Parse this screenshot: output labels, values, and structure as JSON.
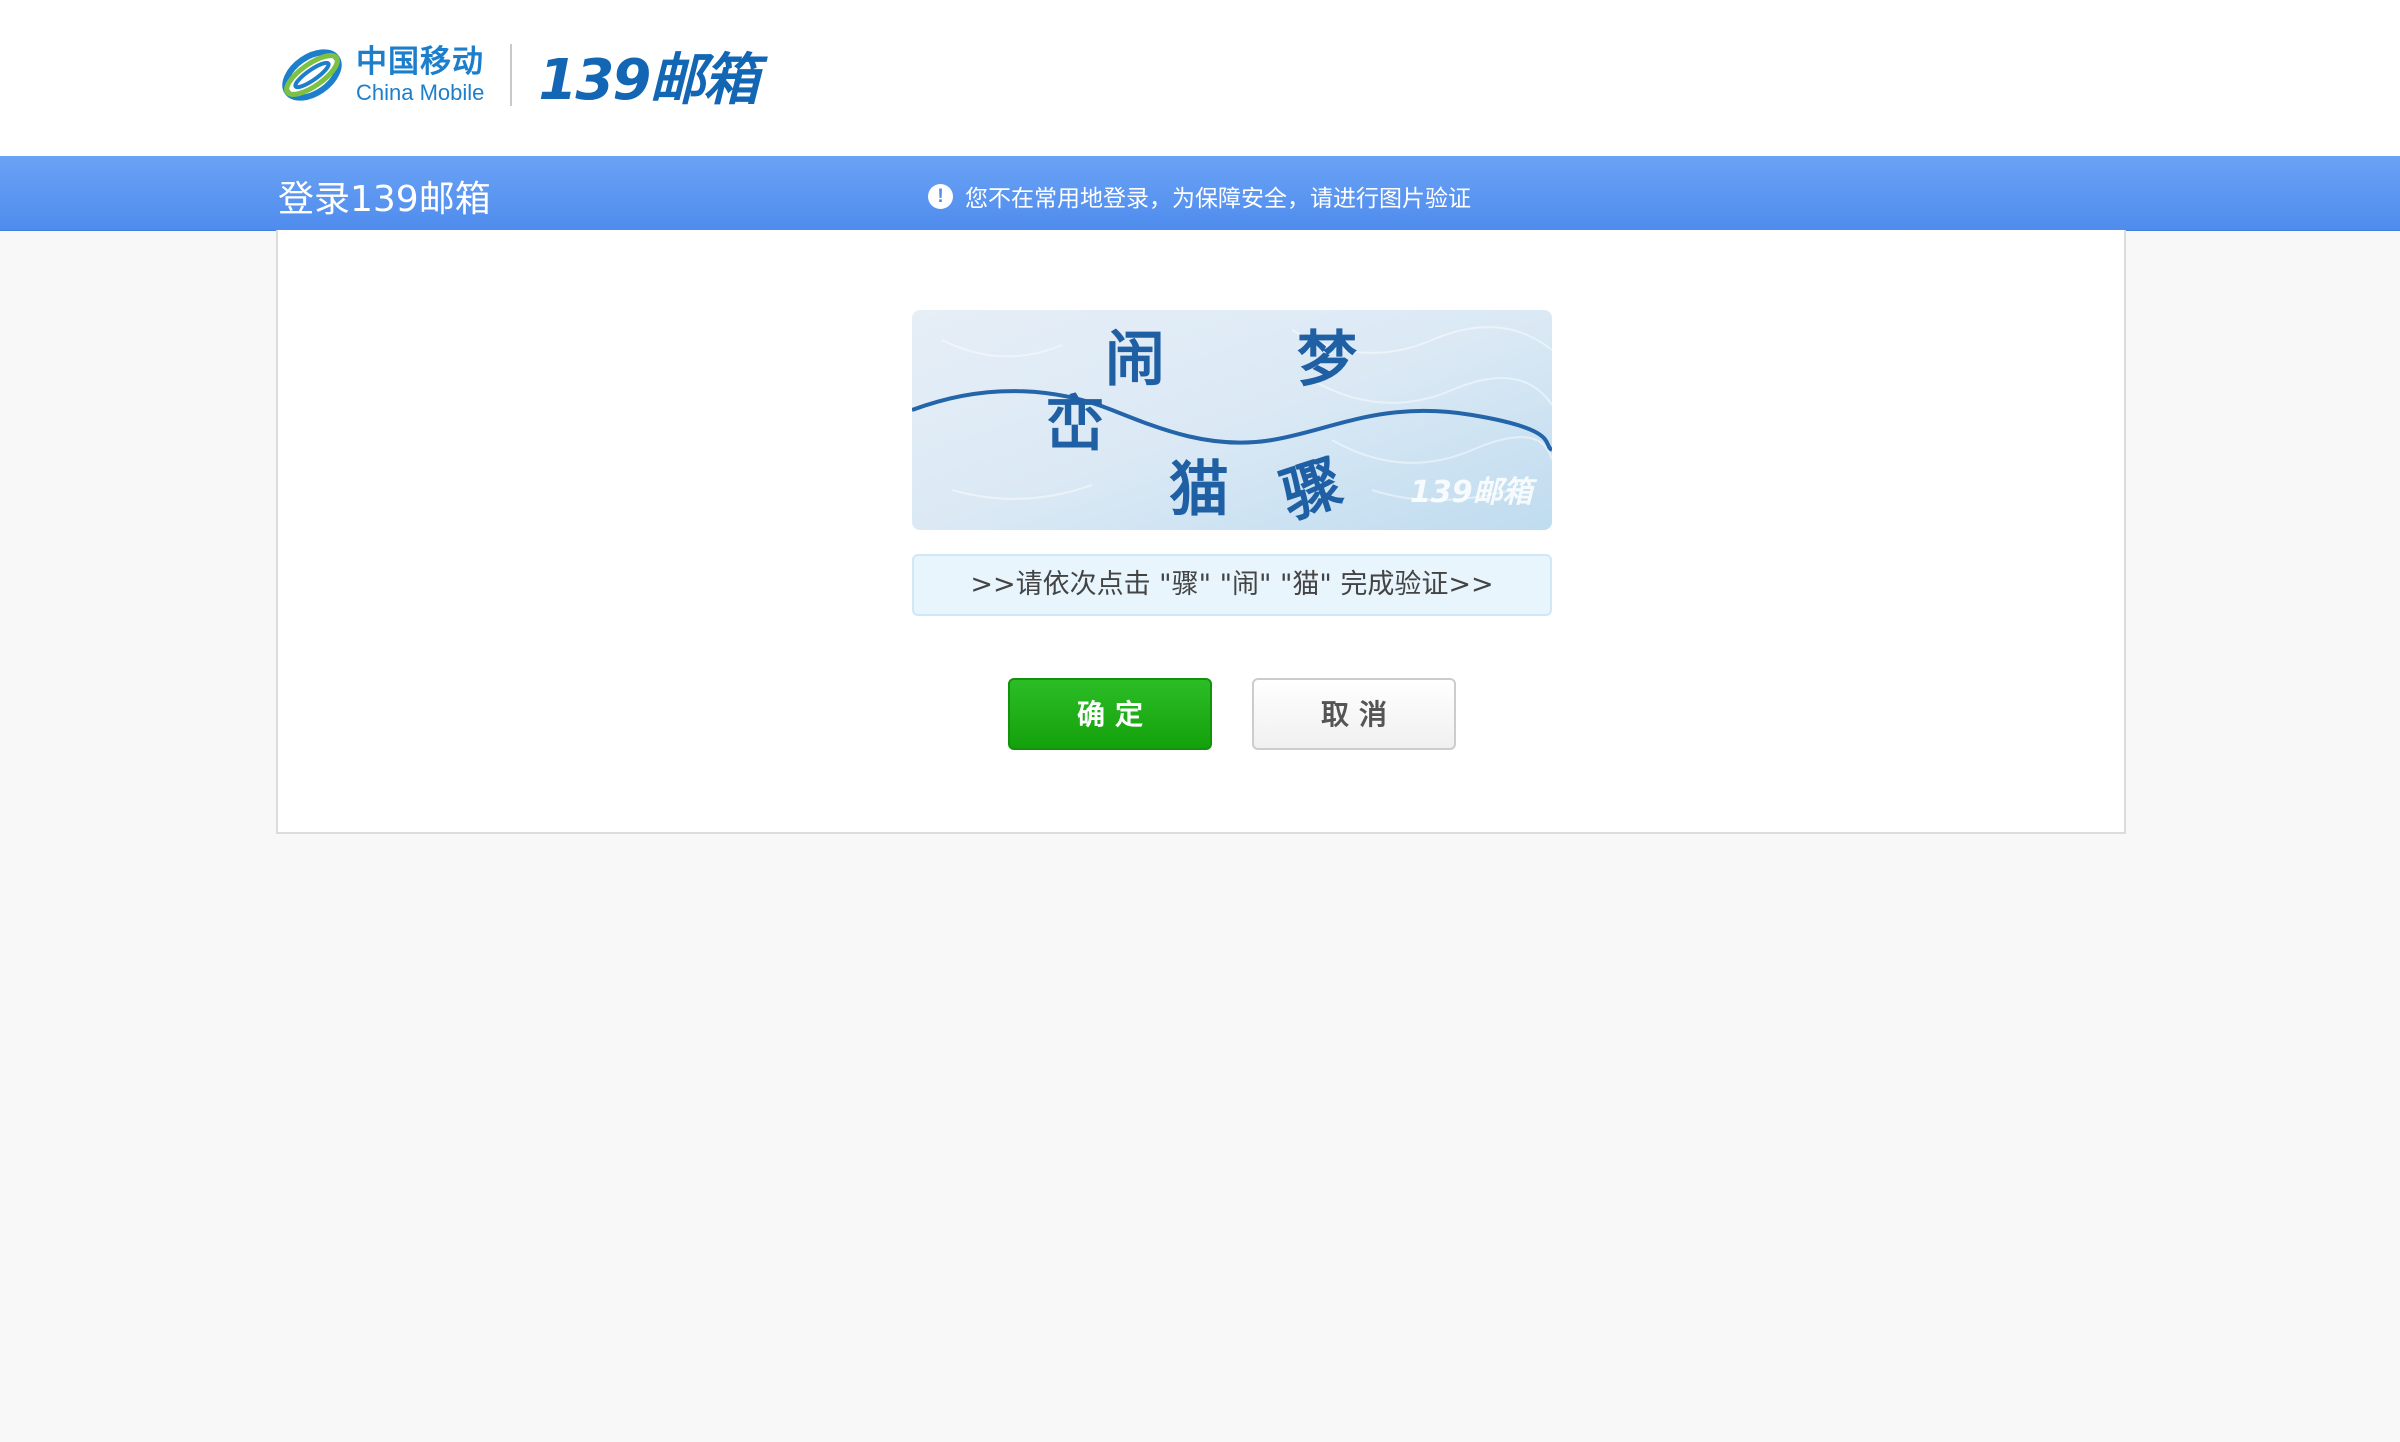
{
  "header": {
    "brand_cn": "中国移动",
    "brand_en": "China Mobile",
    "mail_logo": "139邮箱",
    "brand_color": "#1d7fcb"
  },
  "bar": {
    "title": "登录139邮箱",
    "notice_icon": "!",
    "notice": "您不在常用地登录，为保障安全，请进行图片验证",
    "color": "#5b97f0"
  },
  "captcha": {
    "characters": [
      "闹",
      "梦",
      "峦",
      "猫",
      "骤"
    ],
    "watermark": "139邮箱",
    "hint": ">>请依次点击 \"骤\" \"闹\" \"猫\" 完成验证>>"
  },
  "buttons": {
    "confirm": "确定",
    "cancel": "取消"
  }
}
